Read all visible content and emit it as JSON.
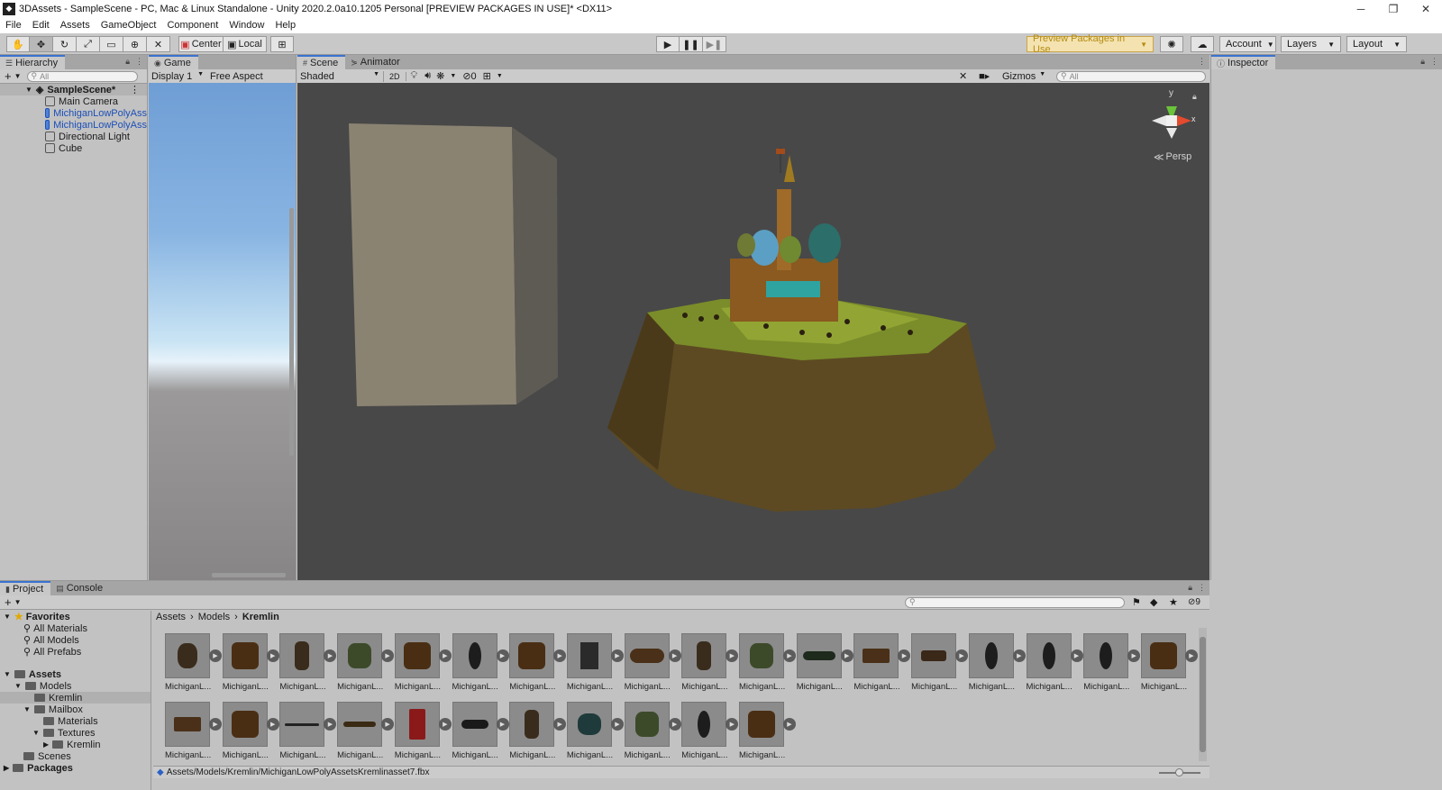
{
  "window": {
    "title": "3DAssets - SampleScene - PC, Mac & Linux Standalone - Unity 2020.2.0a10.1205 Personal [PREVIEW PACKAGES IN USE]* <DX11>"
  },
  "menu": [
    "File",
    "Edit",
    "Assets",
    "GameObject",
    "Component",
    "Window",
    "Help"
  ],
  "toolbar": {
    "pivot_label": "Center",
    "space_label": "Local",
    "preview_label": "Preview Packages in Use",
    "account_label": "Account",
    "layers_label": "Layers",
    "layout_label": "Layout"
  },
  "hierarchy": {
    "tab": "Hierarchy",
    "search_placeholder": "All",
    "scene": "SampleScene*",
    "items": [
      "Main Camera",
      "MichiganLowPolyAss",
      "MichiganLowPolyAss",
      "Directional Light",
      "Cube"
    ]
  },
  "game": {
    "tab": "Game",
    "display": "Display 1",
    "aspect": "Free Aspect"
  },
  "scene": {
    "tab": "Scene",
    "tab2": "Animator",
    "draw_mode": "Shaded",
    "mode_2d": "2D",
    "hidden_count": "0",
    "gizmos": "Gizmos",
    "search_placeholder": "All",
    "persp": "Persp",
    "axis_y": "y",
    "axis_x": "x"
  },
  "inspector": {
    "tab": "Inspector"
  },
  "project": {
    "tab": "Project",
    "tab2": "Console",
    "badge": "9",
    "breadcrumb": [
      "Assets",
      "Models",
      "Kremlin"
    ],
    "favorites": {
      "label": "Favorites",
      "items": [
        "All Materials",
        "All Models",
        "All Prefabs"
      ]
    },
    "tree": {
      "assets": "Assets",
      "models": "Models",
      "kremlin": "Kremlin",
      "mailbox": "Mailbox",
      "materials": "Materials",
      "textures": "Textures",
      "kremlin2": "Kremlin",
      "scenes": "Scenes",
      "packages": "Packages"
    },
    "asset_label": "MichiganL...",
    "status_path": "Assets/Models/Kremlin/MichiganLowPolyAssetsKremlinasset7.fbx"
  },
  "colors": {
    "accent": "#3a72d0",
    "scene_bg": "#484848",
    "selection_blue": "#1c4fb8",
    "preview_gold": "#b48b12"
  }
}
